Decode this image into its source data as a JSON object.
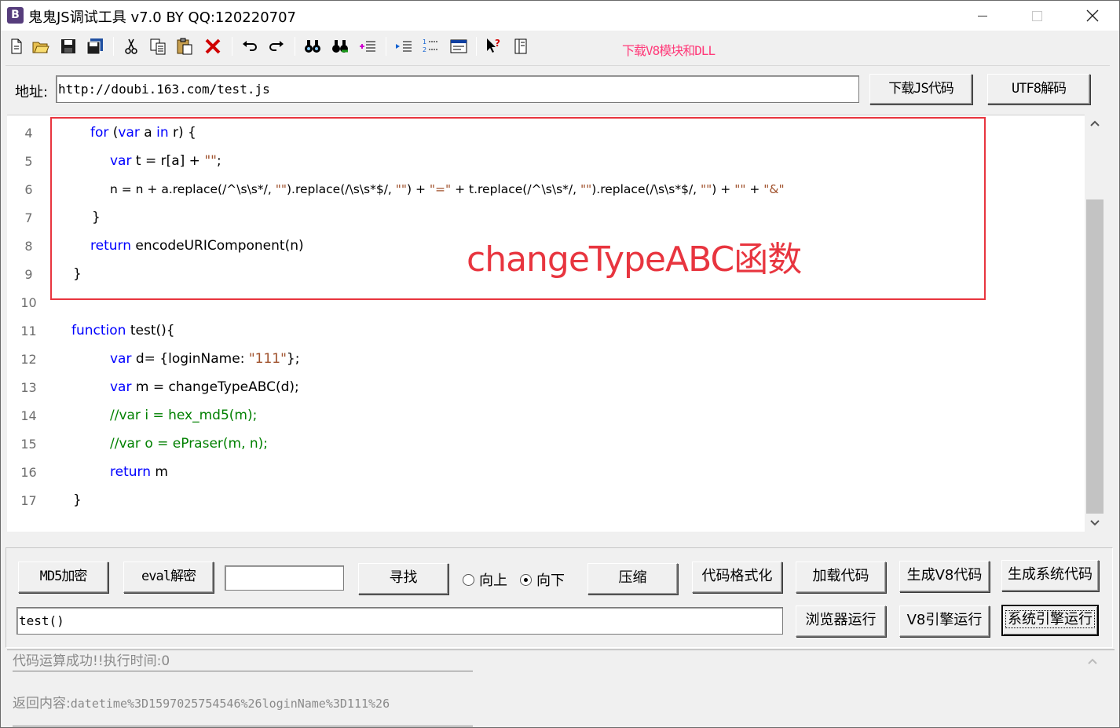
{
  "window": {
    "title": "鬼鬼JS调试工具 v7.0 BY QQ:120220707",
    "icon_letter": "B"
  },
  "toolbar": {
    "icons": [
      "new-file-icon",
      "open-folder-icon",
      "save-icon",
      "save-all-icon",
      "cut-icon",
      "copy-icon",
      "paste-icon",
      "delete-icon",
      "undo-icon",
      "redo-icon",
      "find-icon",
      "find-next-icon",
      "indent-icon",
      "outdent-icon",
      "numbered-list-icon",
      "window-icon",
      "help-icon",
      "panel-icon"
    ],
    "download_link": "下载V8模块和DLL"
  },
  "address": {
    "label": "地址:",
    "url": "http://doubi.163.com/test.js",
    "download_button": "下载JS代码",
    "utf8_button": "UTF8解码"
  },
  "editor": {
    "lines": [
      {
        "num": "4"
      },
      {
        "num": "5"
      },
      {
        "num": "6"
      },
      {
        "num": "7"
      },
      {
        "num": "8"
      },
      {
        "num": "9"
      },
      {
        "num": "10"
      },
      {
        "num": "11"
      },
      {
        "num": "12"
      },
      {
        "num": "13"
      },
      {
        "num": "14"
      },
      {
        "num": "15"
      },
      {
        "num": "16"
      },
      {
        "num": "17"
      }
    ],
    "tokens": {
      "l4_for": "for",
      "l4_a": " (",
      "l4_var": "var",
      "l4_b": " a ",
      "l4_in": "in",
      "l4_c": " r) {",
      "l5_var": "var",
      "l5_a": " t = r[a] + ",
      "l5_str": "\"\"",
      "l5_b": ";",
      "l6_a": "n = n + a.replace(/^\\s\\s*/, ",
      "l6_s1": "\"\"",
      "l6_b": ").replace(/\\s\\s*$/, ",
      "l6_s2": "\"\"",
      "l6_c": ") + ",
      "l6_s3": "\"=\"",
      "l6_d": " + t.replace(/^\\s\\s*/, ",
      "l6_s4": "\"\"",
      "l6_e": ").replace(/\\s\\s*$/, ",
      "l6_s5": "\"\"",
      "l6_f": ") + ",
      "l6_s6": "\"\"",
      "l6_g": " + ",
      "l6_s7": "\"&\"",
      "l7": "}",
      "l8_return": "return",
      "l8_a": " encodeURIComponent(n)",
      "l9": "}",
      "l11_function": "function",
      "l11_a": " test(){",
      "l12_var": "var",
      "l12_a": " d= {loginName: ",
      "l12_str": "\"111\"",
      "l12_b": "};",
      "l13_var": "var",
      "l13_a": " m = changeTypeABC(d);",
      "l14": "//var i = hex_md5(m);",
      "l15": "//var o = ePraser(m, n);",
      "l16_return": "return",
      "l16_a": " m",
      "l17": "}"
    }
  },
  "annotation": {
    "text": "changeTypeABC函数",
    "color": "#e8353f"
  },
  "controls": {
    "md5_button": "MD5加密",
    "eval_button": "eval解密",
    "search_value": "",
    "find_button": "寻找",
    "radio_up": "向上",
    "radio_down": "向下",
    "direction_selected": "向下",
    "compress_button": "压缩",
    "format_button": "代码格式化",
    "load_button": "加载代码",
    "gen_v8_button": "生成V8代码",
    "gen_sys_button": "生成系统代码",
    "function_input": "test()",
    "browser_run_button": "浏览器运行",
    "v8_run_button": "V8引擎运行",
    "sys_run_button": "系统引擎运行"
  },
  "output": {
    "status": "代码运算成功!!执行时间:0",
    "return_label": "返回内容:",
    "return_value": "datetime%3D1597025754546%26loginName%3D111%26"
  }
}
